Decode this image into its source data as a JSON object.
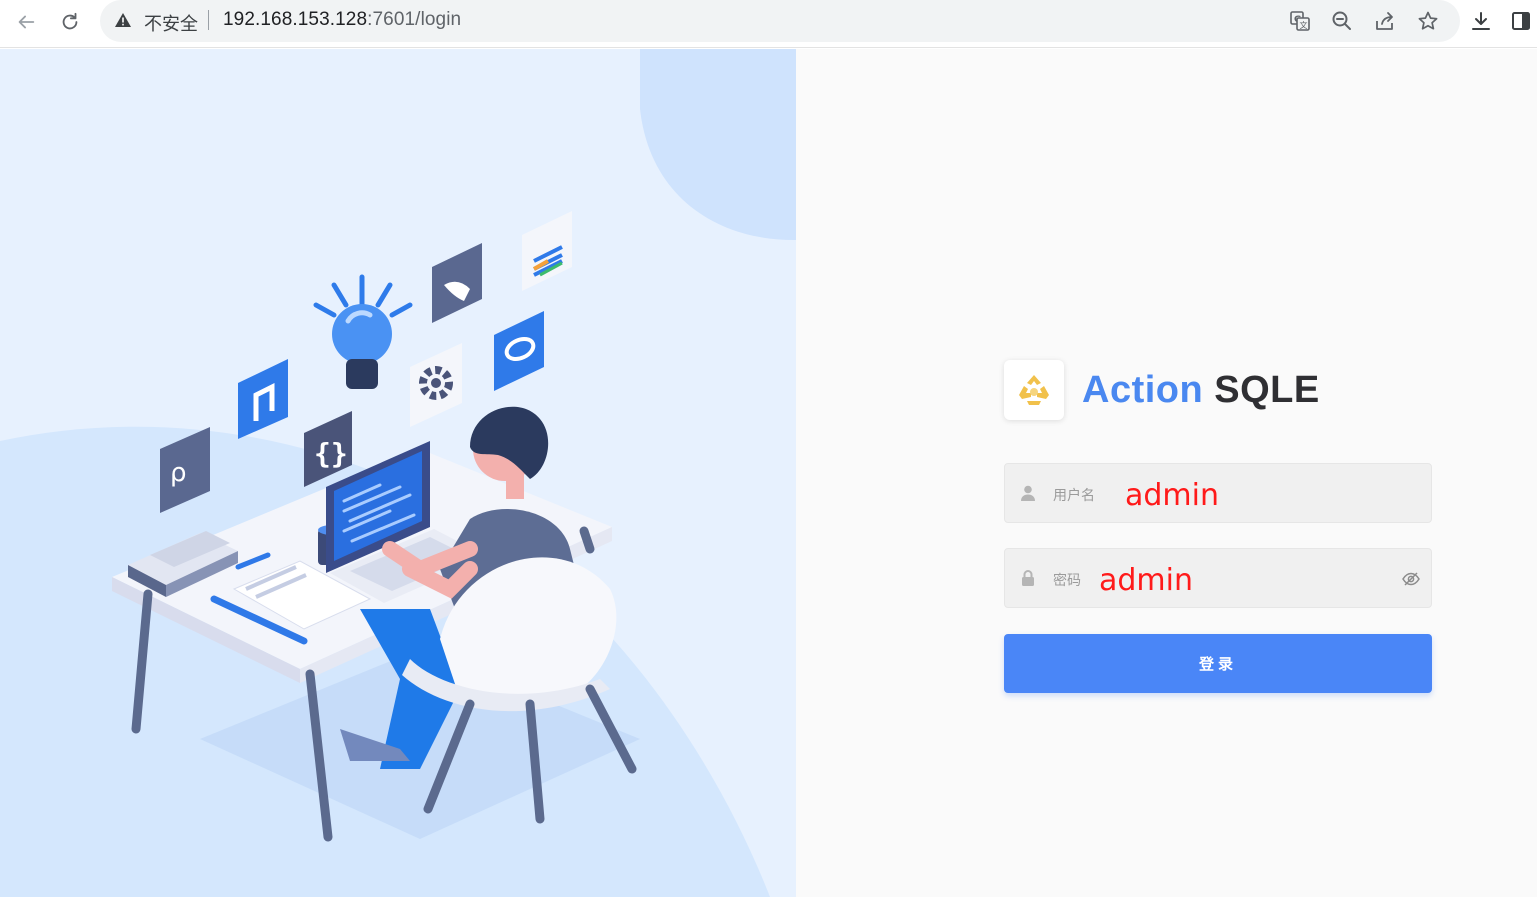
{
  "browser": {
    "security_label": "不安全",
    "url_host": "192.168.153.128",
    "url_rest": ":7601/login",
    "icons": [
      "back-arrow-icon",
      "reload-icon",
      "warning-icon",
      "translate-icon",
      "zoom-out-icon",
      "share-icon",
      "bookmark-star-icon",
      "download-icon",
      "side-panel-icon"
    ]
  },
  "brand": {
    "name_accent": "Action",
    "name_rest": "SQLE",
    "logo_color": "#f1c14b",
    "accent_color": "#4a88f0"
  },
  "login_form": {
    "username": {
      "placeholder": "用户名",
      "value": "admin"
    },
    "password": {
      "placeholder": "密码",
      "value": "admin"
    },
    "submit_label": "登录",
    "button_color": "#4a86f7",
    "annotation_color": "#ff1a1a"
  },
  "illustration": {
    "description_icons": [
      "lightbulb-icon",
      "gear-icon",
      "code-braces-icon",
      "database-icons",
      "person-at-desk"
    ]
  }
}
